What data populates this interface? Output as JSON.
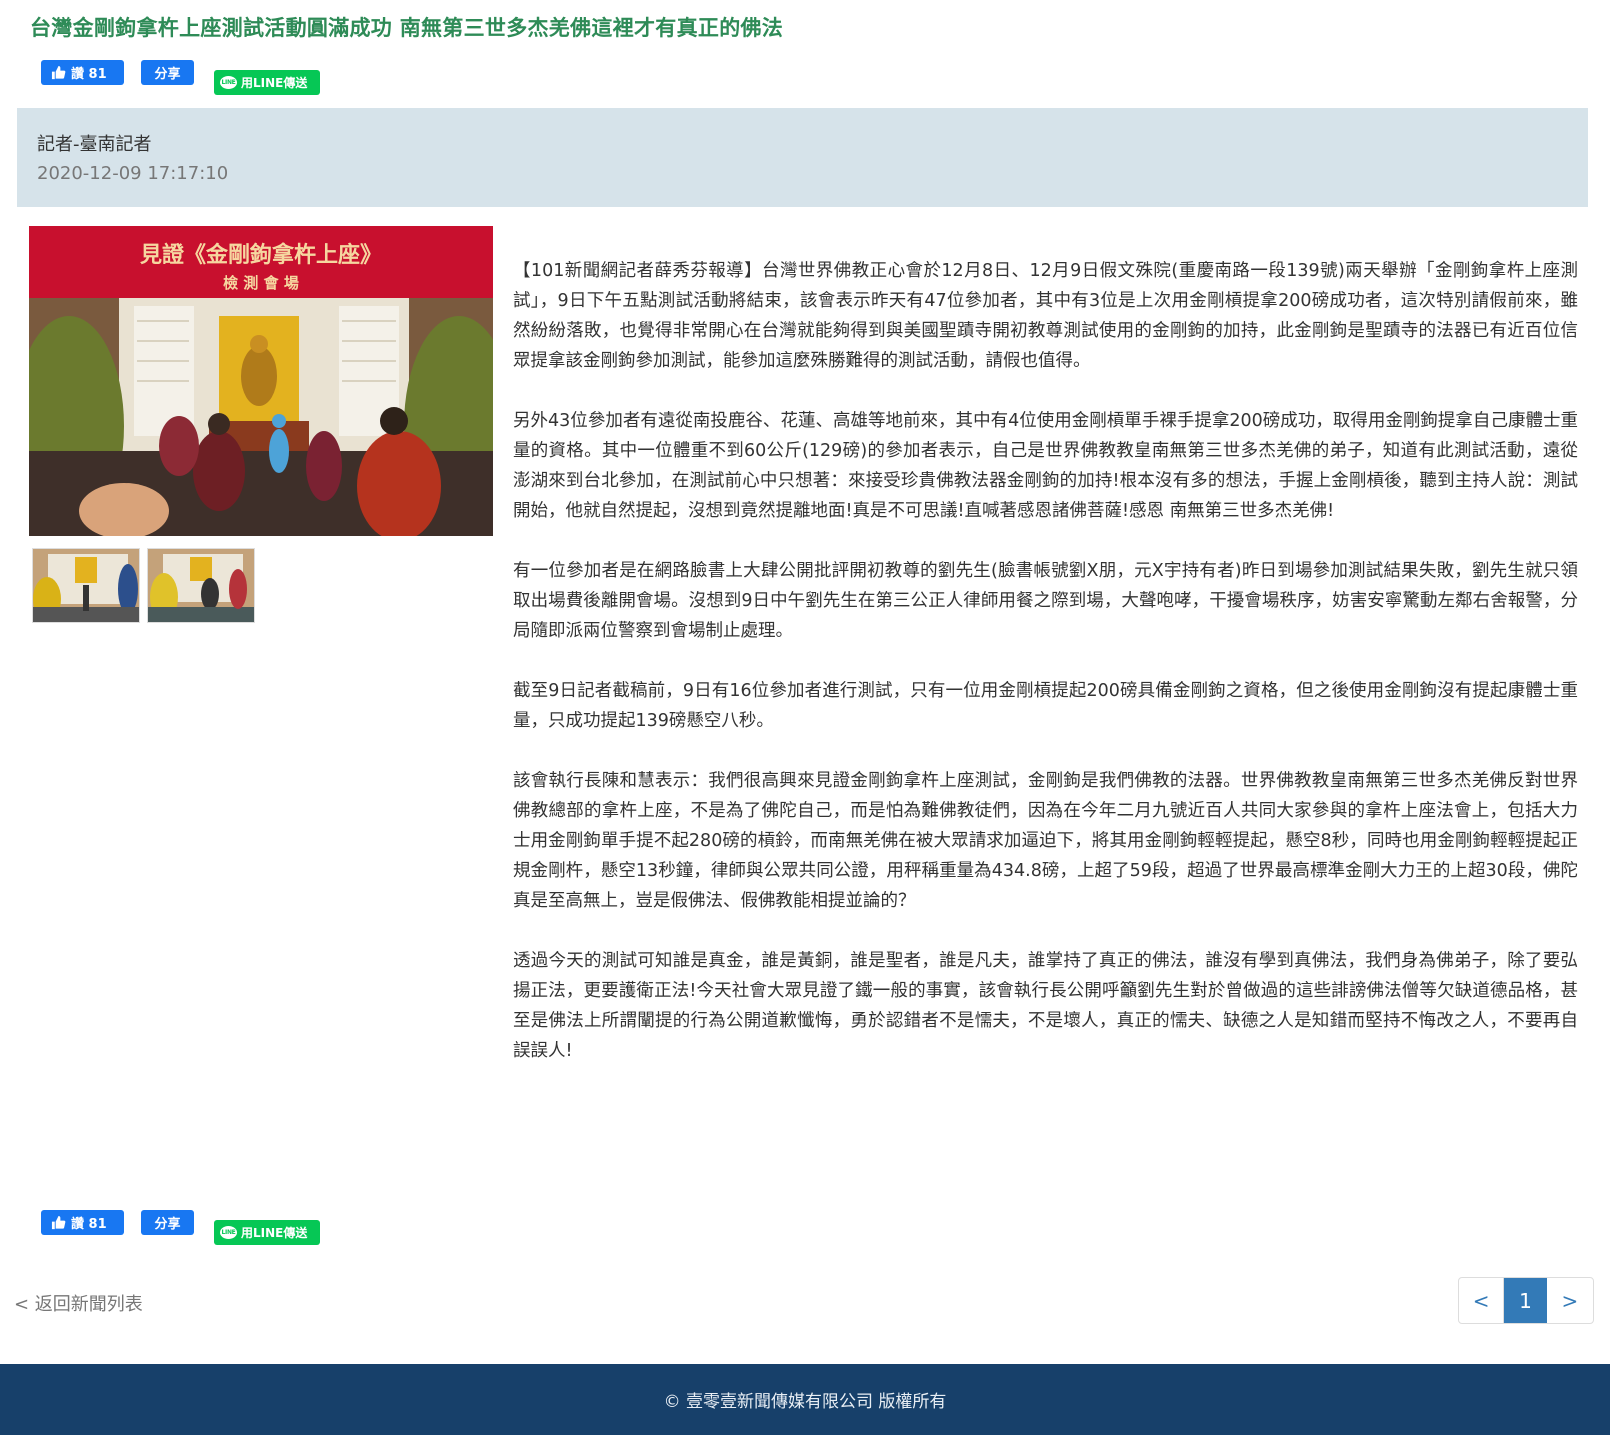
{
  "article": {
    "title": "台灣金剛鉤拿杵上座測試活動圓滿成功 南無第三世多杰羌佛這裡才有真正的佛法",
    "author": "記者-臺南記者",
    "date": "2020-12-09 17:17:10",
    "paragraphs": [
      "【101新聞網記者薛秀芬報導】台灣世界佛教正心會於12月8日、12月9日假文殊院(重慶南路一段139號)兩天舉辦「金剛鉤拿杵上座測試」，9日下午五點測試活動將結束，該會表示昨天有47位參加者，其中有3位是上次用金剛槓提拿200磅成功者，這次特別請假前來，雖然紛紛落敗，也覺得非常開心在台灣就能夠得到與美國聖蹟寺開初教尊測試使用的金剛鉤的加持，此金剛鉤是聖蹟寺的法器已有近百位信眾提拿該金剛鉤參加測試，能參加這麼殊勝難得的測試活動，請假也值得。",
      "另外43位參加者有遠從南投鹿谷、花蓮、高雄等地前來，其中有4位使用金剛槓單手裸手提拿200磅成功，取得用金剛鉤提拿自己康體士重量的資格。其中一位體重不到60公斤(129磅)的參加者表示，自己是世界佛教教皇南無第三世多杰羌佛的弟子，知道有此測試活動，遠從澎湖來到台北參加，在測試前心中只想著：來接受珍貴佛教法器金剛鉤的加持!根本沒有多的想法，手握上金剛槓後，聽到主持人說：測試開始，他就自然提起，沒想到竟然提離地面!真是不可思議!直喊著感恩諸佛菩薩!感恩 南無第三世多杰羌佛!",
      "有一位參加者是在網路臉書上大肆公開批評開初教尊的劉先生(臉書帳號劉X朋，元X宇持有者)昨日到場參加測試結果失敗，劉先生就只領取出場費後離開會場。沒想到9日中午劉先生在第三公正人律師用餐之際到場，大聲咆哮，干擾會場秩序，妨害安寧驚動左鄰右舍報警，分局隨即派兩位警察到會場制止處理。",
      "截至9日記者截稿前，9日有16位參加者進行測試，只有一位用金剛槓提起200磅具備金剛鉤之資格，但之後使用金剛鉤沒有提起康體士重量，只成功提起139磅懸空八秒。",
      "該會執行長陳和慧表示：我們很高興來見證金剛鉤拿杵上座測試，金剛鉤是我們佛教的法器。世界佛教教皇南無第三世多杰羌佛反對世界佛教總部的拿杵上座，不是為了佛陀自己，而是怕為難佛教徒們，因為在今年二月九號近百人共同大家參與的拿杵上座法會上，包括大力士用金剛鉤單手提不起280磅的槓鈴，而南無羌佛在被大眾請求加逼迫下，將其用金剛鉤輕輕提起，懸空8秒，同時也用金剛鉤輕輕提起正規金剛杵，懸空13秒鐘，律師與公眾共同公證，用秤稱重量為434.8磅，上超了59段，超過了世界最高標準金剛大力王的上超30段，佛陀真是至高無上，豈是假佛法、假佛教能相提並論的？",
      "透過今天的測試可知誰是真金，誰是黃銅，誰是聖者，誰是凡夫，誰掌持了真正的佛法，誰沒有學到真佛法，我們身為佛弟子，除了要弘揚正法，更要護衛正法!今天社會大眾見證了鐵一般的事實，該會執行長公開呼籲劉先生對於曾做過的這些誹謗佛法僧等欠缺道德品格，甚至是佛法上所謂闡提的行為公開道歉懺悔，勇於認錯者不是懦夫，不是壞人，真正的懦夫、缺德之人是知錯而堅持不悔改之人，不要再自誤誤人!"
    ]
  },
  "share": {
    "like_label": "讚 81",
    "share_label": "分享",
    "line_label": "用LINE傳送",
    "line_icon_text": "LINE"
  },
  "photo": {
    "banner_line1": "見證《金剛鉤拿杵上座》",
    "banner_line2": "檢 測 會 場"
  },
  "nav": {
    "back_label": "< 返回新聞列表",
    "prev_label": "<",
    "current_page": "1",
    "next_label": ">"
  },
  "footer": {
    "copyright": "© 壹零壹新聞傳媒有限公司 版權所有"
  },
  "colors": {
    "title": "#2e8b57",
    "facebook": "#1877f2",
    "line": "#06c755",
    "author_box": "#d6e3ea",
    "pager_active": "#337ab7",
    "footer_bg": "#17406a"
  }
}
